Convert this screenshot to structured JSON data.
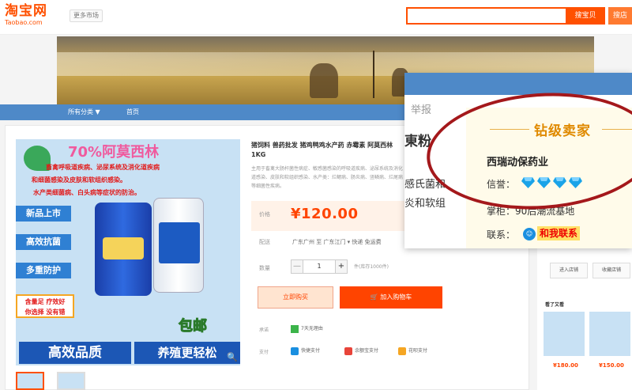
{
  "header": {
    "logo_cn": "淘宝网",
    "logo_en": "Taobao.com",
    "more_markets": "更多市场",
    "search_button": "搜宝贝",
    "search_button_2": "搜店"
  },
  "nav": {
    "items": [
      {
        "label": "所有分类 ▼"
      },
      {
        "label": "首页"
      }
    ]
  },
  "product": {
    "image_text": {
      "headline": "70%阿莫西林",
      "claim_1": "畜禽呼吸道疾病、泌尿系统及消化道疾病",
      "claim_2": "和细菌感染及皮肤和软组织感染。",
      "claim_3": "水产类细菌病、白头病等症状的防治。",
      "tags": [
        "新品上市",
        "高效抗菌",
        "多重防护"
      ],
      "tag_badge": [
        "含量足 疗效好",
        "你选择 没有错"
      ],
      "baoyou": "包邮",
      "bottom_left": "高效品质",
      "bottom_right": "养殖更轻松"
    },
    "title": "猪饲料 兽药批发 猪鸡鸭鸡水产药 赤霉素 阿莫西林 1KG",
    "description": "主用于畜禽大肠杆菌性病症、敏感菌感染的呼吸道疾病、泌尿系统及消化道感染、皮肤和软组织感染、水产类：烂鳃病、肠炎病、竖鳞病、烂尾病等细菌性疾病。",
    "price_label": "价格",
    "price": "¥120.00",
    "ship_label": "配送",
    "ship_value": "广东广州 至  广东江门 ▾   快递 免运费",
    "qty_label": "数量",
    "qty_minus": "—",
    "qty_value": "1",
    "qty_plus": "+",
    "stock": "件(库存1000件)",
    "buy_now": "立即购买",
    "add_to_cart": "加入购物车",
    "promise_label": "承诺",
    "promise": "7天无理由",
    "pay_label": "支付",
    "pay_methods": [
      "快捷支付",
      "余额宝支付",
      "花呗支付"
    ]
  },
  "sidebar": {
    "enter_store": "进入店铺",
    "follow_store": "收藏店铺",
    "viewed_title": "看了又看",
    "prices": [
      "¥180.00",
      "¥150.00"
    ]
  },
  "popup": {
    "report": "举报",
    "frag_title": "東粉",
    "frag_line1": "感氏菌和",
    "frag_line2": "炎和软组",
    "seller_level": "钻级卖家",
    "shop_name": "西瑞动保药业",
    "reputation_label": "信誉：",
    "diamonds": 4,
    "seller_label": "掌柜：90后潮流基地",
    "contact_label": "联系：",
    "contact_button": "和我联系",
    "colors": {
      "accent": "#ff5000",
      "mark": "#a4181b",
      "diamond": "#1aa3e8"
    }
  }
}
